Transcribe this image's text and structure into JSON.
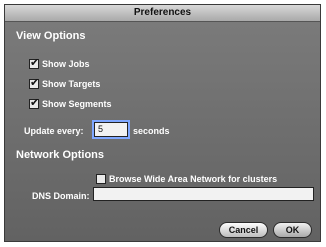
{
  "window": {
    "title": "Preferences"
  },
  "view_options": {
    "heading": "View Options",
    "show_jobs": {
      "label": "Show Jobs",
      "checked": true
    },
    "show_targets": {
      "label": "Show Targets",
      "checked": true
    },
    "show_segments": {
      "label": "Show Segments",
      "checked": true
    },
    "update_label": "Update every:",
    "update_value": "5",
    "update_units": "seconds"
  },
  "network_options": {
    "heading": "Network Options",
    "browse_wan": {
      "label": "Browse Wide Area Network for clusters",
      "checked": false
    },
    "dns_label": "DNS Domain:",
    "dns_value": ""
  },
  "buttons": {
    "cancel": "Cancel",
    "ok": "OK"
  }
}
